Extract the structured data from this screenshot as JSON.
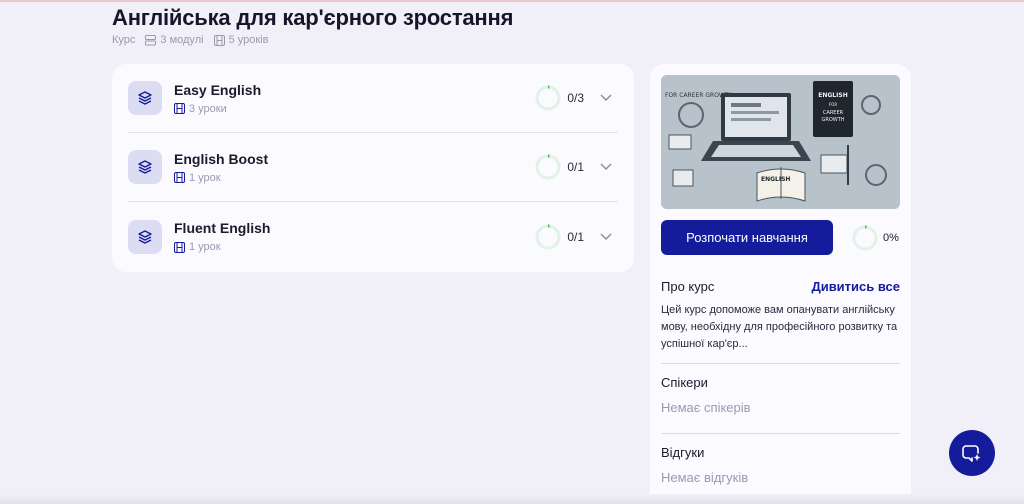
{
  "course": {
    "title": "Англійська для кар'єрного зростання",
    "type": "Курс",
    "modules_count": "3 модулі",
    "lessons_count": "5 уроків"
  },
  "modules": [
    {
      "name": "Easy English",
      "lessons": "3 уроки",
      "progress": "0/3"
    },
    {
      "name": "English Boost",
      "lessons": "1 урок",
      "progress": "0/1"
    },
    {
      "name": "Fluent English",
      "lessons": "1 урок",
      "progress": "0/1"
    }
  ],
  "sidebar": {
    "cover": {
      "caption_left": "FOR CAREER GROWTH",
      "book_title": "ENGLISH FOR CAREER GROWTH",
      "book2_title": "ENGLISH"
    },
    "start_button": "Розпочати навчання",
    "progress_percent": "0%",
    "about": {
      "title": "Про курс",
      "see_all": "Дивитись все",
      "text": "Цей курс допоможе вам опанувати англійську мову, необхідну для професійного розвитку та успішної кар'єр..."
    },
    "speakers": {
      "title": "Спікери",
      "empty": "Немає спікерів"
    },
    "reviews": {
      "title": "Відгуки",
      "empty": "Немає відгуків"
    }
  },
  "colors": {
    "accent": "#151c9b",
    "module_icon_bg": "#dcdcf3",
    "progress_ring": "#e2f3e6"
  },
  "icons": {
    "module": "layers-icon",
    "lessons": "film-icon",
    "modules_meta": "rows-icon",
    "chevron": "chevron-down-icon",
    "fab": "ai-sparkle-icon"
  }
}
